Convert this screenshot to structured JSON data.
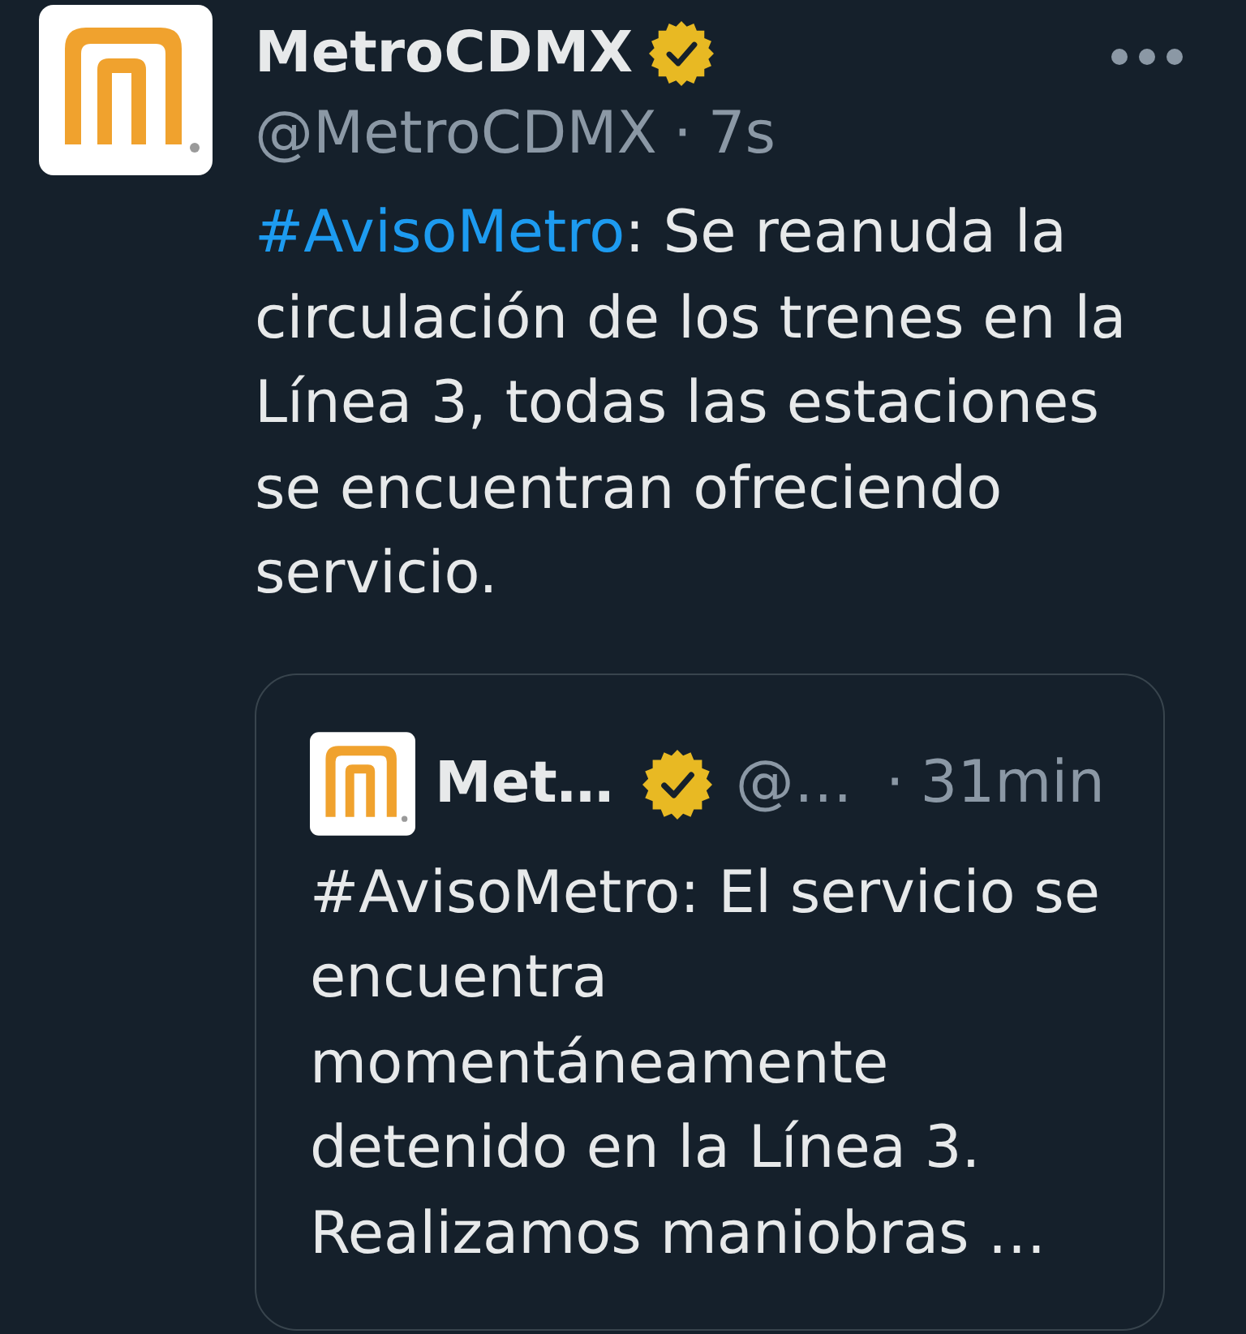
{
  "tweet": {
    "author": {
      "name": "MetroCDMX",
      "verified": true,
      "handle": "@MetroCDMX",
      "separator": "·",
      "time": "7s"
    },
    "text": {
      "hashtag": "#AvisoMetro",
      "body": ": Se reanuda la\ncirculación de los trenes en la\nLínea 3, todas las estaciones\nse encuentran ofreciendo\nservicio."
    },
    "quoted_tweet": {
      "author": {
        "name": "Met…",
        "verified": true,
        "handle": "@…",
        "separator": "·",
        "time": "31min"
      },
      "text": "#AvisoMetro: El servicio se\nencuentra\nmomentáneamente\ndetenido en la Línea 3.\nRealizamos maniobras …"
    }
  }
}
